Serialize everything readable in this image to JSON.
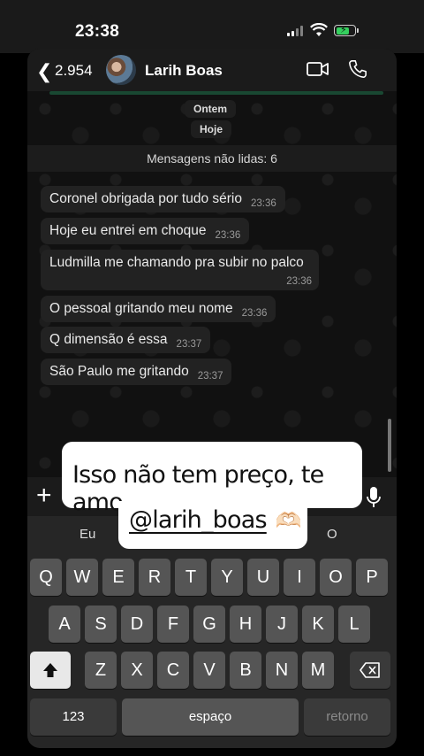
{
  "status": {
    "time": "23:38"
  },
  "header": {
    "back_count": "2.954",
    "contact_name": "Larih Boas"
  },
  "chat": {
    "date_yesterday": "Ontem",
    "date_today": "Hoje",
    "unread_label": "Mensagens não lidas: 6",
    "messages": [
      {
        "text": "Coronel obrigada por tudo sério",
        "time": "23:36"
      },
      {
        "text": "Hoje eu entrei em choque",
        "time": "23:36"
      },
      {
        "text": "Ludmilla me chamando pra subir no palco",
        "time": "23:36"
      },
      {
        "text": "O pessoal gritando meu nome",
        "time": "23:36"
      },
      {
        "text": "Q dimensão é essa",
        "time": "23:37"
      },
      {
        "text": "São Paulo me gritando",
        "time": "23:37"
      }
    ]
  },
  "keyboard": {
    "suggestions": [
      "Eu",
      "O"
    ],
    "row1": [
      "Q",
      "W",
      "E",
      "R",
      "T",
      "Y",
      "U",
      "I",
      "O",
      "P"
    ],
    "row2": [
      "A",
      "S",
      "D",
      "F",
      "G",
      "H",
      "J",
      "K",
      "L"
    ],
    "row3": [
      "Z",
      "X",
      "C",
      "V",
      "B",
      "N",
      "M"
    ],
    "numbers_label": "123",
    "space_label": "espaço",
    "return_label": "retorno"
  },
  "sticker": {
    "line1": "Isso não tem preço, te amo",
    "mention": "@larih_boas",
    "emoji": "🫶🏻"
  },
  "icons": {
    "back": "chevron-left-icon",
    "video": "video-camera-icon",
    "call": "phone-icon",
    "add": "plus-icon",
    "mic": "microphone-icon",
    "shift": "shift-icon",
    "delete": "backspace-icon"
  },
  "colors": {
    "bubble": "#222222",
    "battery": "#35d05e",
    "sticker_bg": "#ffffff"
  }
}
